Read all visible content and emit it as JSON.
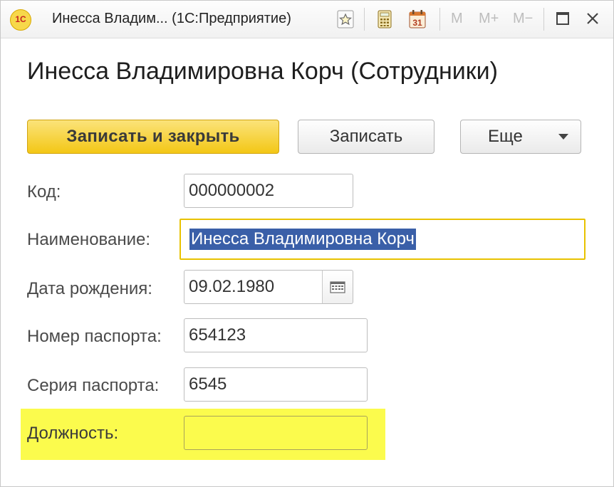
{
  "window": {
    "logo_text": "1С",
    "title": "Инесса Владим...  (1С:Предприятие)",
    "toolbar_icons": [
      "favorite-star-icon",
      "calculator-icon",
      "calendar-icon"
    ],
    "memory_buttons": [
      "M",
      "M+",
      "M−"
    ],
    "window_buttons": [
      "maximize-icon",
      "close-icon"
    ]
  },
  "form": {
    "heading": "Инесса Владимировна Корч (Сотрудники)",
    "commands": {
      "save_close_label": "Записать и закрыть",
      "save_label": "Записать",
      "more_label": "Еще"
    },
    "fields": {
      "code": {
        "label": "Код:",
        "value": "000000002"
      },
      "name": {
        "label": "Наименование:",
        "value": "Инесса Владимировна Корч"
      },
      "birth_date": {
        "label": "Дата рождения:",
        "value": "09.02.1980"
      },
      "passport_number": {
        "label": "Номер паспорта:",
        "value": "654123"
      },
      "passport_series": {
        "label": "Серия паспорта:",
        "value": "6545"
      },
      "position": {
        "label": "Должность:",
        "value": ""
      }
    }
  },
  "colors": {
    "primary_button": "#f3c716",
    "focus_border": "#e8c200",
    "selection": "#3a5fa8",
    "highlight": "#fbfb4d"
  }
}
